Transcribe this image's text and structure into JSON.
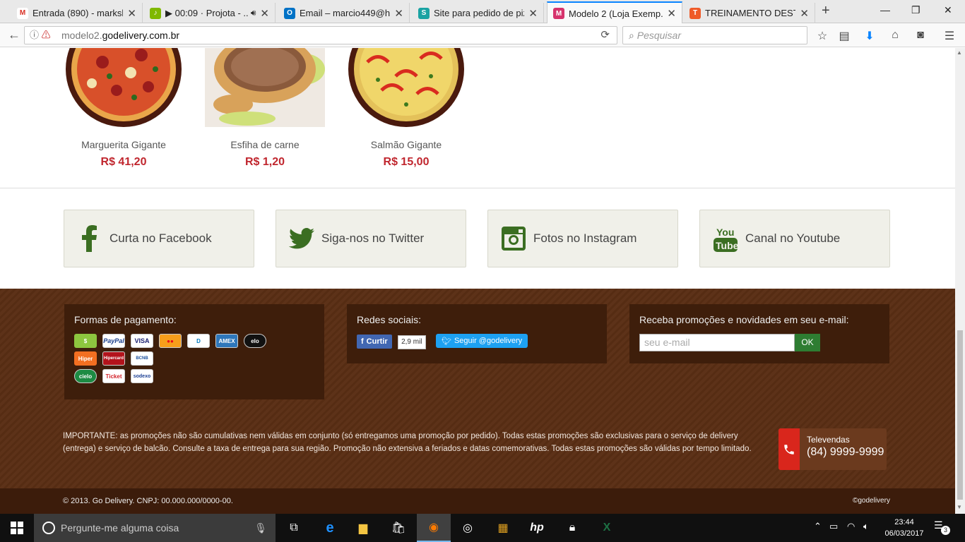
{
  "browser": {
    "tabs": [
      {
        "title": "Entrada (890) - marksh",
        "icon": "gmail-icon",
        "color": "#d93025",
        "glyph": "M"
      },
      {
        "title": "▶ 00:09 · Projota - ...",
        "icon": "music-icon",
        "color": "#7fb800",
        "glyph": "♪"
      },
      {
        "title": "Email – marcio449@h...",
        "icon": "outlook-icon",
        "color": "#0072c6",
        "glyph": "O"
      },
      {
        "title": "Site para pedido de piz...",
        "icon": "site-icon",
        "color": "#1aa3a3",
        "glyph": "S"
      },
      {
        "title": "Modelo 2 (Loja Exemp...",
        "icon": "store-icon",
        "color": "#d6336c",
        "glyph": "M"
      },
      {
        "title": "TREINAMENTO DEST...",
        "icon": "training-icon",
        "color": "#ef5a28",
        "glyph": "T"
      }
    ],
    "url_prefix": "modelo2.",
    "url_domain": "godelivery.com.br",
    "search_placeholder": "Pesquisar"
  },
  "products": [
    {
      "name": "Marguerita Gigante",
      "price": "R$ 41,20"
    },
    {
      "name": "Esfiha de carne",
      "price": "R$ 1,20"
    },
    {
      "name": "Salmão Gigante",
      "price": "R$ 15,00"
    }
  ],
  "social_links": [
    {
      "label": "Curta no Facebook",
      "icon": "facebook-icon"
    },
    {
      "label": "Siga-nos no Twitter",
      "icon": "twitter-icon"
    },
    {
      "label": "Fotos no Instagram",
      "icon": "instagram-icon"
    },
    {
      "label": "Canal no Youtube",
      "icon": "youtube-icon"
    }
  ],
  "footer": {
    "payment_title": "Formas de pagamento:",
    "payment_methods": [
      [
        "$",
        "PayPal",
        "VISA",
        "MC",
        "D",
        "AMEX",
        "elo"
      ],
      [
        "Hiper",
        "Hipercard",
        "BCNB"
      ],
      [
        "cielo",
        "Ticket",
        "sodexo"
      ]
    ],
    "social_title": "Redes sociais:",
    "fb_like": "Curtir",
    "fb_count": "2,9 mil",
    "twitter_follow": "Seguir @godelivery",
    "newsletter_title": "Receba promoções e novidades em seu e-mail:",
    "email_placeholder": "seu e-mail",
    "ok": "OK",
    "notice": "IMPORTANTE: as promoções não são cumulativas nem válidas em conjunto (só entregamos uma promoção por pedido). Todas estas promoções são exclusivas para o serviço de delivery (entrega) e serviço de balcão. Consulte a taxa de entrega para sua região. Promoção não extensiva a feriados e datas comemorativas. Todas estas promoções são válidas por tempo limitado.",
    "televendas_label": "Televendas",
    "televendas_phone": "(84) 9999-9999",
    "copyright": "© 2013. Go Delivery. CNPJ: 00.000.000/0000-00.",
    "signature": "©godelivery"
  },
  "taskbar": {
    "search_placeholder": "Pergunte-me alguma coisa",
    "time": "23:44",
    "date": "06/03/2017",
    "notifications": "3"
  },
  "colors": {
    "price": "#c0262e",
    "social_icon": "#3b6e22",
    "footer_bg": "#5a2e14",
    "footer_box": "#3e1e0b",
    "ok_button": "#2e7d32",
    "phone_red": "#d9261c"
  }
}
